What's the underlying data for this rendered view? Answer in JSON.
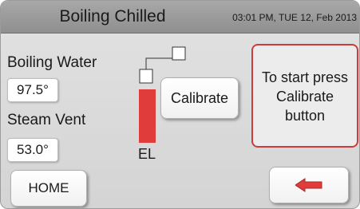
{
  "header": {
    "title": "Boiling Chilled",
    "datetime": "03:01 PM, TUE 12, Feb 2013"
  },
  "readings": {
    "boiling_water_label": "Boiling Water",
    "boiling_water_value": "97.5°",
    "steam_vent_label": "Steam Vent",
    "steam_vent_value": "53.0°"
  },
  "indicator": {
    "label": "EL",
    "color": "#e03c3c"
  },
  "buttons": {
    "calibrate": "Calibrate",
    "home": "HOME",
    "back_icon": "left-arrow-icon"
  },
  "message": {
    "line1": "To start press",
    "line2": "Calibrate",
    "line3": "button"
  },
  "colors": {
    "accent_red": "#e03c3c",
    "message_border": "#cc3c3c"
  }
}
